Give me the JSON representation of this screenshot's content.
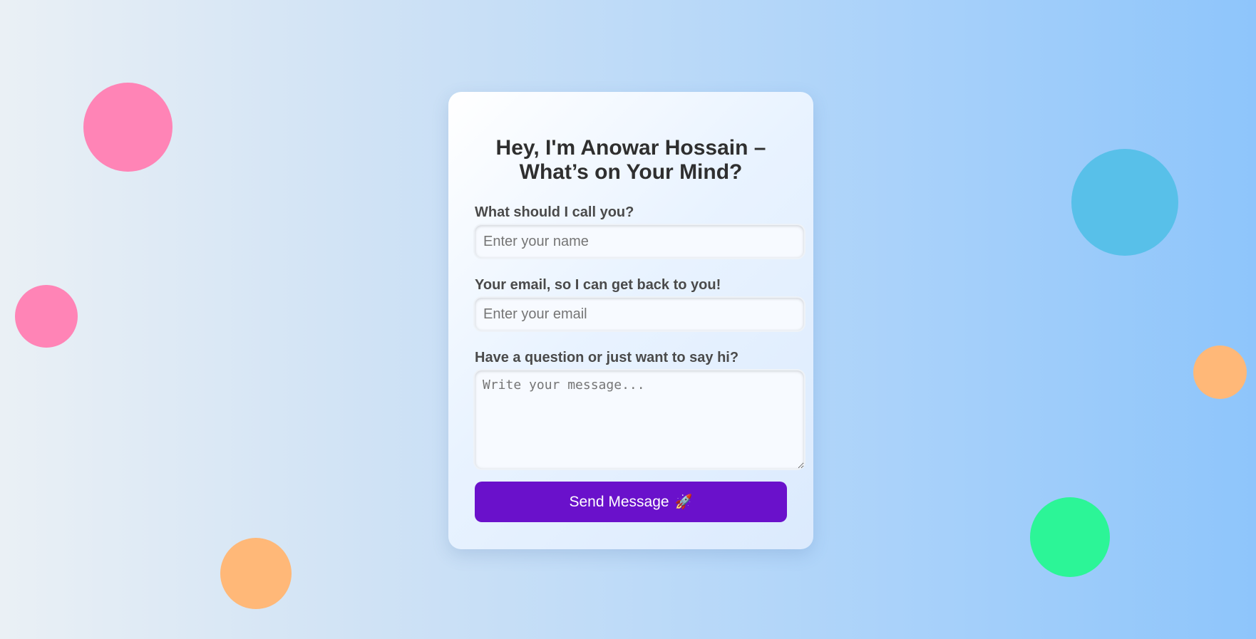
{
  "form": {
    "title": "Hey, I'm Anowar Hossain – What’s on Your Mind?",
    "name_label": "What should I call you?",
    "name_placeholder": "Enter your name",
    "email_label": "Your email, so I can get back to you!",
    "email_placeholder": "Enter your email",
    "message_label": "Have a question or just want to say hi?",
    "message_placeholder": "Write your message...",
    "send_label": "Send Message",
    "send_icon": "🚀"
  },
  "colors": {
    "accent": "#6a11cb",
    "bubble_pink": "#ff84b6",
    "bubble_orange": "#ffb878",
    "bubble_blue": "#58c0e9",
    "bubble_green": "#2cf597"
  },
  "icons": {
    "send_button_icon": "rocket-icon"
  }
}
